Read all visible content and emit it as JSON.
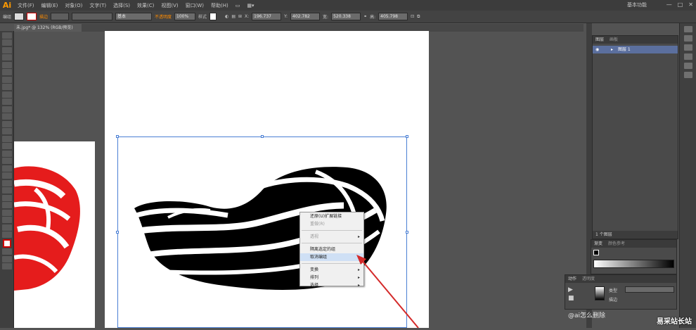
{
  "app": {
    "logo": "Ai"
  },
  "menu": [
    "文件(F)",
    "编辑(E)",
    "对象(O)",
    "文字(T)",
    "选择(S)",
    "效果(C)",
    "视图(V)",
    "窗口(W)",
    "帮助(H)"
  ],
  "workspace_label": "基本功能",
  "window_buttons": [
    "—",
    "□",
    "✕"
  ],
  "control_bar": {
    "selection_label": "编组",
    "stroke_label": "描边",
    "stroke_weight": "基本",
    "opacity_label": "不透明度",
    "opacity_value": "100%",
    "style_label": "样式",
    "x_value": "196.737",
    "y_value": "402.782",
    "w_value": "520.338",
    "h_value": "405.798"
  },
  "doc_tab": "未.jpg* @ 132% (RGB/预览)",
  "context_menu": {
    "items": [
      {
        "label": "还原(U)扩展链接",
        "disabled": false,
        "arrow": false,
        "highlight": false
      },
      {
        "label": "重做(R)",
        "disabled": true,
        "arrow": false,
        "highlight": false
      },
      {
        "label": "透视",
        "disabled": true,
        "arrow": true,
        "highlight": false
      },
      {
        "label": "隔离选定的组",
        "disabled": false,
        "arrow": false,
        "highlight": false
      },
      {
        "label": "取消编组",
        "disabled": false,
        "arrow": false,
        "highlight": true
      },
      {
        "label": "变换",
        "disabled": false,
        "arrow": true,
        "highlight": false
      },
      {
        "label": "排列",
        "disabled": false,
        "arrow": true,
        "highlight": false
      },
      {
        "label": "选择",
        "disabled": false,
        "arrow": true,
        "highlight": false
      }
    ]
  },
  "layers_panel": {
    "tabs": [
      "图层",
      "画板"
    ],
    "layer_name": "图层 1",
    "footer": "1 个图层"
  },
  "gradient_panel": {
    "tabs": [
      "渐变",
      "颜色参考"
    ]
  },
  "mini_panel": {
    "tabs": [
      "动作",
      "透明度"
    ],
    "label": "类型",
    "value": "描边"
  },
  "watermark": {
    "left": "@ai怎么删除",
    "right": "易采站长站"
  },
  "colors": {
    "accent_orange": "#ff9a00",
    "selection_blue": "#4a7fd4",
    "logo_red": "#e51c1c"
  }
}
